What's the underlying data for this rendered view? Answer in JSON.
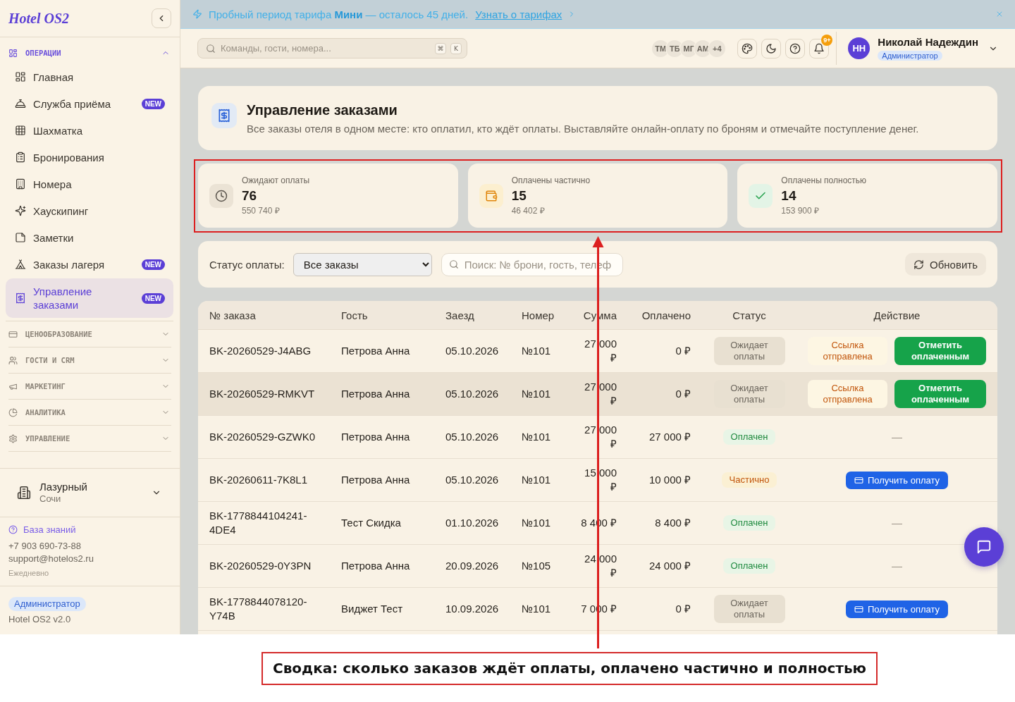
{
  "banner": {
    "text": "Пробный период тарифа **Мини** — осталось 45 дней.",
    "link": "Узнать о тарифах"
  },
  "sidebar": {
    "logo": "Hotel OS2",
    "sections": [
      {
        "label": "ОПЕРАЦИИ",
        "expanded": true,
        "items": [
          {
            "label": "Главная",
            "selected": false
          },
          {
            "label": "Служба приёма",
            "badge": "NEW",
            "selected": false
          },
          {
            "label": "Шахматка",
            "selected": false
          },
          {
            "label": "Бронирования",
            "selected": false
          },
          {
            "label": "Номера",
            "selected": false
          },
          {
            "label": "Хаускипинг",
            "selected": false
          },
          {
            "label": "Заметки",
            "selected": false
          },
          {
            "label": "Заказы лагеря",
            "badge": "NEW",
            "selected": false
          },
          {
            "label": "Управление заказами",
            "badge": "NEW",
            "selected": true
          }
        ]
      },
      {
        "label": "ЦЕНООБРАЗОВАНИЕ",
        "expanded": false
      },
      {
        "label": "ГОСТИ И CRM",
        "expanded": false
      },
      {
        "label": "МАРКЕТИНГ",
        "expanded": false
      },
      {
        "label": "АНАЛИТИКА",
        "expanded": false
      },
      {
        "label": "УПРАВЛЕНИЕ",
        "expanded": false
      }
    ],
    "property": {
      "name": "Лазурный",
      "city": "Сочи"
    },
    "support": {
      "link": "База знаний",
      "phone": "+7 903 690-73-88",
      "email": "support@hotelos2.ru",
      "hours": "Ежедневно"
    },
    "footer": {
      "role": "Администратор",
      "version": "Hotel OS2 v2.0"
    }
  },
  "header": {
    "search": {
      "placeholder": "Команды, гости, номера...",
      "keys": [
        "⌘",
        "K"
      ]
    },
    "team": [
      "ТМ",
      "ТБ",
      "МГ",
      "АМ"
    ],
    "team_more": "+4",
    "notifications": "9+",
    "user": {
      "initials": "НН",
      "name": "Николай Надеждин",
      "role": "Администратор"
    }
  },
  "page": {
    "title": "Управление заказами",
    "subtitle": "Все заказы отеля в одном месте: кто оплатил, кто ждёт оплаты. Выставляйте онлайн-оплату по броням и отмечайте поступление денег."
  },
  "stats": [
    {
      "kind": "pending",
      "label": "Ожидают оплаты",
      "value": "76",
      "amount": "550 740 ₽"
    },
    {
      "kind": "partial",
      "label": "Оплачены частично",
      "value": "15",
      "amount": "46 402 ₽"
    },
    {
      "kind": "paid",
      "label": "Оплачены полностью",
      "value": "14",
      "amount": "153 900 ₽"
    }
  ],
  "filters": {
    "label": "Статус оплаты:",
    "status": "Все заказы",
    "search": {
      "placeholder": "Поиск: № брони, гость, телеф"
    },
    "refresh": "Обновить"
  },
  "table": {
    "columns": [
      "№ заказа",
      "Гость",
      "Заезд",
      "Номер",
      "Сумма",
      "Оплачено",
      "Статус",
      "Действие"
    ],
    "rows": [
      {
        "cells": [
          "BK-20260529-J4ABG",
          "Петрова Анна",
          "05.10.2026",
          "№101",
          "27 000 ₽",
          "0 ₽"
        ],
        "status": {
          "kind": "pending",
          "label": "Ожидает оплаты"
        },
        "actions": [
          {
            "kind": "sent",
            "label": "Ссылка отправлена"
          },
          {
            "kind": "mark_paid",
            "label": "Отметить оплаченным"
          }
        ],
        "highlighted": false
      },
      {
        "cells": [
          "BK-20260529-RMKVT",
          "Петрова Анна",
          "05.10.2026",
          "№101",
          "27 000 ₽",
          "0 ₽"
        ],
        "status": {
          "kind": "pending",
          "label": "Ожидает оплаты"
        },
        "actions": [
          {
            "kind": "sent",
            "label": "Ссылка отправлена"
          },
          {
            "kind": "mark_paid",
            "label": "Отметить оплаченным"
          }
        ],
        "highlighted": true
      },
      {
        "cells": [
          "BK-20260529-GZWK0",
          "Петрова Анна",
          "05.10.2026",
          "№101",
          "27 000 ₽",
          "27 000 ₽"
        ],
        "status": {
          "kind": "paid",
          "label": "Оплачен"
        },
        "actions": [
          {
            "kind": "none",
            "label": "—"
          }
        ],
        "highlighted": false
      },
      {
        "cells": [
          "BK-20260611-7K8L1",
          "Петрова Анна",
          "05.10.2026",
          "№101",
          "15 000 ₽",
          "10 000 ₽"
        ],
        "status": {
          "kind": "partial",
          "label": "Частично"
        },
        "actions": [
          {
            "kind": "get_payment",
            "label": "Получить оплату"
          }
        ],
        "highlighted": false
      },
      {
        "cells": [
          "BK-1778844104241-4DE4",
          "Тест Скидка",
          "01.10.2026",
          "№101",
          "8 400 ₽",
          "8 400 ₽"
        ],
        "status": {
          "kind": "paid",
          "label": "Оплачен"
        },
        "actions": [
          {
            "kind": "none",
            "label": "—"
          }
        ],
        "highlighted": false
      },
      {
        "cells": [
          "BK-20260529-0Y3PN",
          "Петрова Анна",
          "20.09.2026",
          "№105",
          "24 000 ₽",
          "24 000 ₽"
        ],
        "status": {
          "kind": "paid",
          "label": "Оплачен"
        },
        "actions": [
          {
            "kind": "none",
            "label": "—"
          }
        ],
        "highlighted": false
      },
      {
        "cells": [
          "BK-1778844078120-Y74B",
          "Виджет Тест",
          "10.09.2026",
          "№101",
          "7 000 ₽",
          "0 ₽"
        ],
        "status": {
          "kind": "pending",
          "label": "Ожидает оплаты"
        },
        "actions": [
          {
            "kind": "get_payment",
            "label": "Получить оплату"
          }
        ],
        "highlighted": false
      }
    ]
  },
  "annotation": {
    "caption": "Сводка: сколько заказов ждёт оплаты, оплачено частично и полностью"
  }
}
